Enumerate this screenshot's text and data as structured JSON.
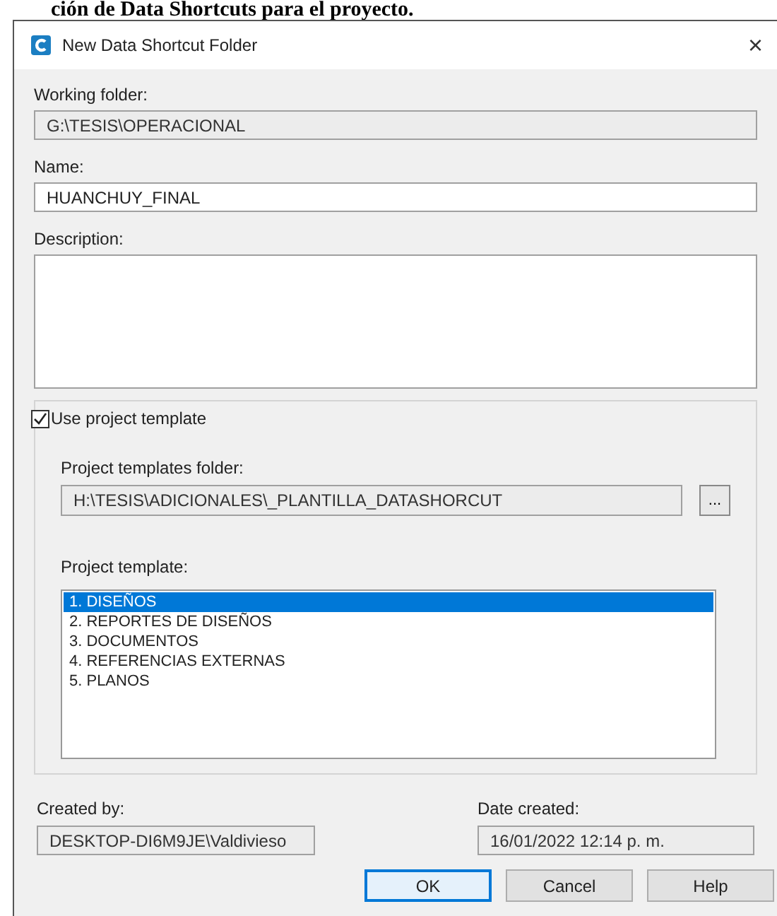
{
  "caption": "ción de Data Shortcuts para el proyecto.",
  "window": {
    "title": "New Data Shortcut Folder",
    "close": "×"
  },
  "working_folder": {
    "label": "Working folder:",
    "value": "G:\\TESIS\\OPERACIONAL"
  },
  "name": {
    "label": "Name:",
    "value": "HUANCHUY_FINAL"
  },
  "description": {
    "label": "Description:"
  },
  "use_template": {
    "label": "Use project template",
    "checked": true
  },
  "templates_folder": {
    "label": "Project templates folder:",
    "value": "H:\\TESIS\\ADICIONALES\\_PLANTILLA_DATASHORCUT",
    "browse": "..."
  },
  "project_template": {
    "label": "Project template:",
    "items": [
      {
        "label": "1. DISEÑOS",
        "selected": true
      },
      {
        "label": "2. REPORTES DE DISEÑOS",
        "selected": false
      },
      {
        "label": "3. DOCUMENTOS",
        "selected": false
      },
      {
        "label": "4. REFERENCIAS EXTERNAS",
        "selected": false
      },
      {
        "label": "5. PLANOS",
        "selected": false
      }
    ]
  },
  "created_by": {
    "label": "Created by:",
    "value": "DESKTOP-DI6M9JE\\Valdivieso"
  },
  "date_created": {
    "label": "Date created:",
    "value": "16/01/2022 12:14 p. m."
  },
  "buttons": [
    {
      "label": "OK",
      "default": true
    },
    {
      "label": "Cancel",
      "default": false
    },
    {
      "label": "Help",
      "default": false
    }
  ]
}
